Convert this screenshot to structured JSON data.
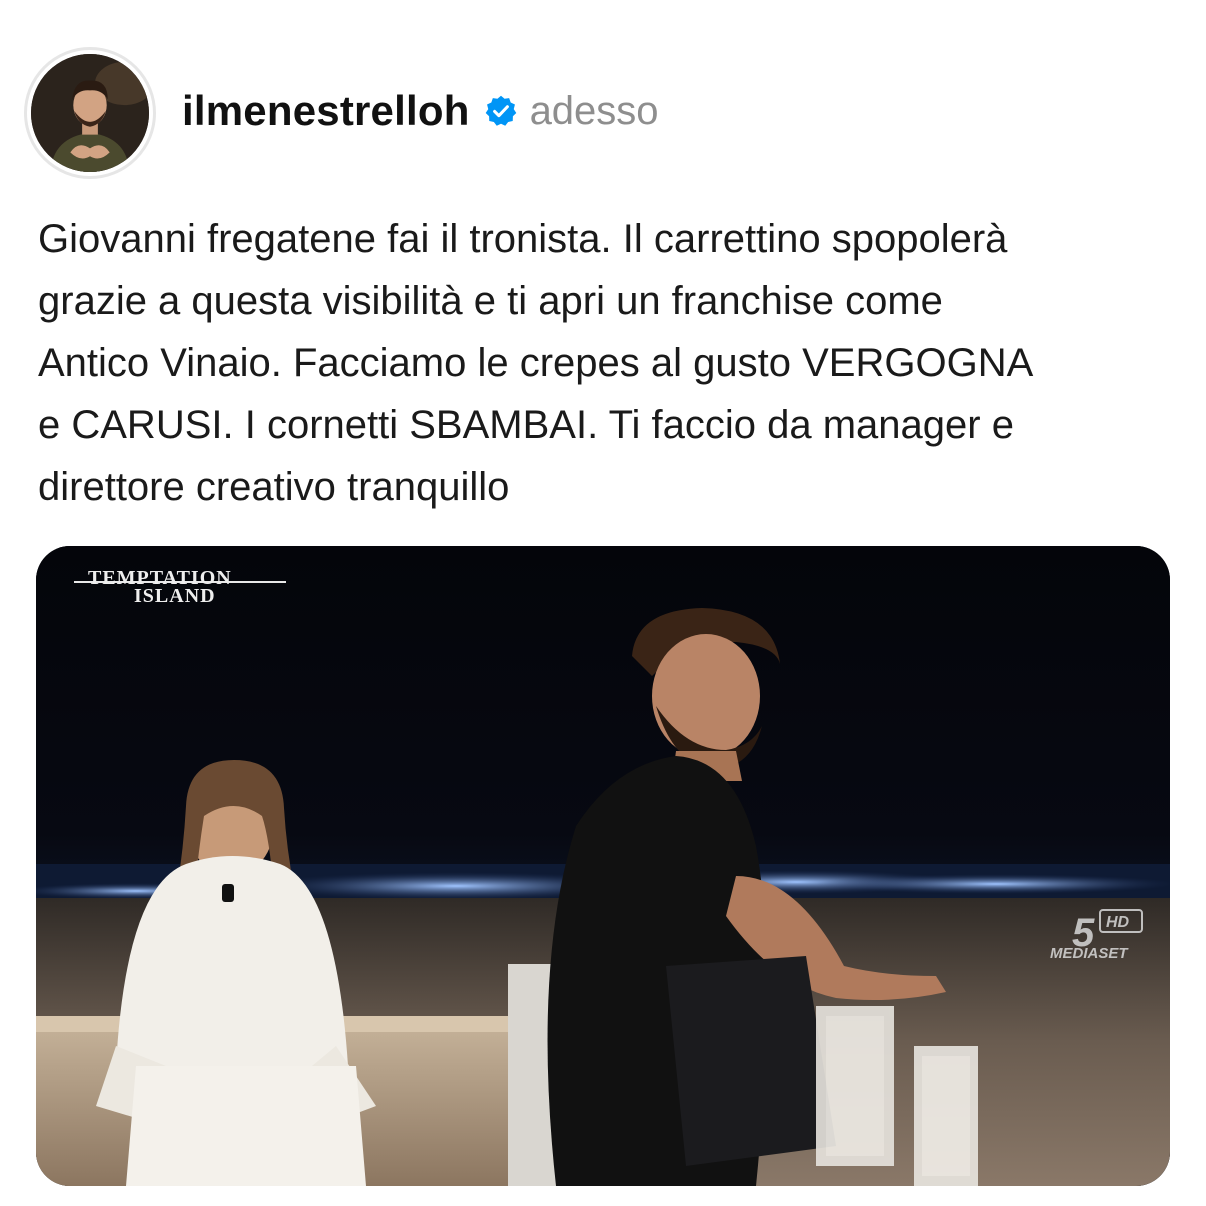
{
  "post": {
    "username": "ilmenestrelloh",
    "timestamp": "adesso",
    "verified_icon": "verified-badge-icon",
    "verified_color": "#0095f6",
    "caption": "Giovanni fregatene fai il tronista. Il carrettino spopolerà\ngrazie a questa visibilità e ti apri un franchise come\nAntico Vinaio. Facciamo le crepes al gusto VERGOGNA\ne CARUSI. I cornetti SBAMBAI. Ti faccio da manager e\ndirettore creativo tranquillo"
  },
  "media": {
    "show_logo_line1": "TEMPTATION",
    "show_logo_line2": "ISLAND",
    "channel_number": "5",
    "channel_badge": "HD",
    "broadcaster": "MEDIASET"
  }
}
